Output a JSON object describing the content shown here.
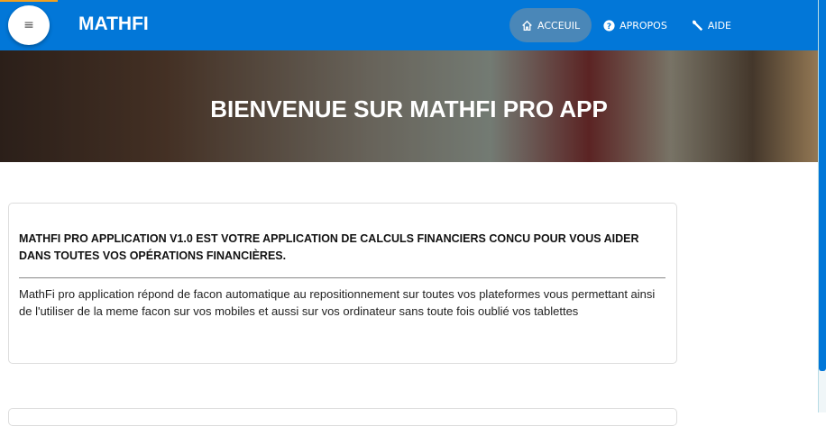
{
  "header": {
    "brand": "MATHFI",
    "menu_icon": "hamburger-icon",
    "nav": [
      {
        "label": "ACCEUIL",
        "icon": "home-icon"
      },
      {
        "label": "APROPOS",
        "icon": "question-icon"
      },
      {
        "label": "AIDE",
        "icon": "wrench-icon"
      }
    ]
  },
  "hero": {
    "title": "BIENVENUE SUR MATHFI PRO APP"
  },
  "card": {
    "heading": "MATHFI PRO APPLICATION V1.0 EST VOTRE APPLICATION DE CALCULS FINANCIERS CONCU POUR VOUS AIDER DANS TOUTES VOS OPÉRATIONS FINANCIÈRES.",
    "body": "MathFi pro application répond de facon automatique au repositionnement sur toutes vos plateformes vous permettant ainsi de l'utiliser de la meme facon sur vos mobiles et aussi sur vos ordinateur sans toute fois oublié vos tablettes"
  },
  "colors": {
    "primary": "#0277d8",
    "accent": "#f0a020"
  }
}
